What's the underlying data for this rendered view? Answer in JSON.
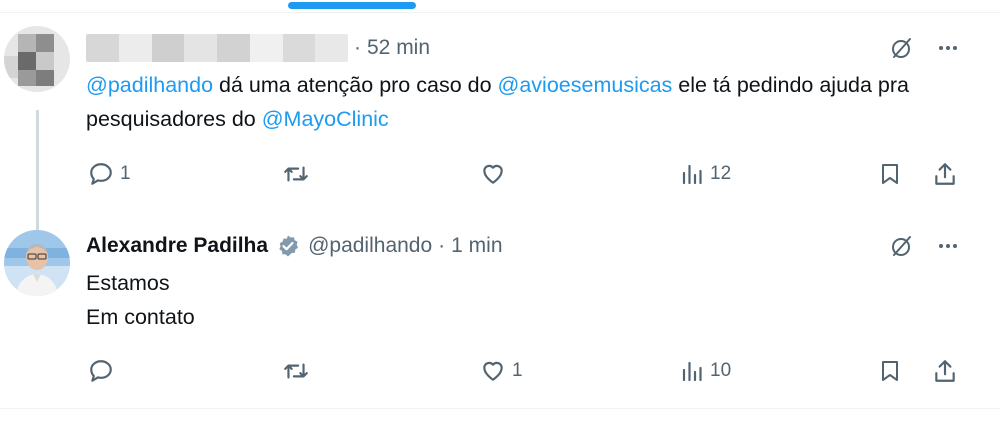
{
  "tweets": [
    {
      "time": "52 min",
      "text_parts": [
        {
          "text": "@padilhando",
          "mention": true
        },
        {
          "text": " dá uma atenção pro caso do ",
          "mention": false
        },
        {
          "text": "@avioesemusicas",
          "mention": true
        },
        {
          "text": " ele tá pedindo ajuda pra pesquisadores do ",
          "mention": false
        },
        {
          "text": "@MayoClinic",
          "mention": true
        }
      ],
      "actions": {
        "replies": "1",
        "reposts": "",
        "likes": "",
        "views": "12"
      }
    },
    {
      "name": "Alexandre Padilha",
      "handle": "@padilhando",
      "time": "1 min",
      "lines": [
        "Estamos",
        "Em contato"
      ],
      "actions": {
        "replies": "",
        "reposts": "",
        "likes": "1",
        "views": "10"
      }
    }
  ],
  "icons": {
    "reply": "reply-icon",
    "repost": "repost-icon",
    "like": "heart-icon",
    "views": "views-icon",
    "bookmark": "bookmark-icon",
    "share": "share-icon",
    "grok": "grok-icon",
    "more": "more-icon",
    "verified": "verified-badge-icon"
  },
  "colors": {
    "accent": "#1d9bf0",
    "muted": "#536471",
    "text": "#0f1419"
  }
}
